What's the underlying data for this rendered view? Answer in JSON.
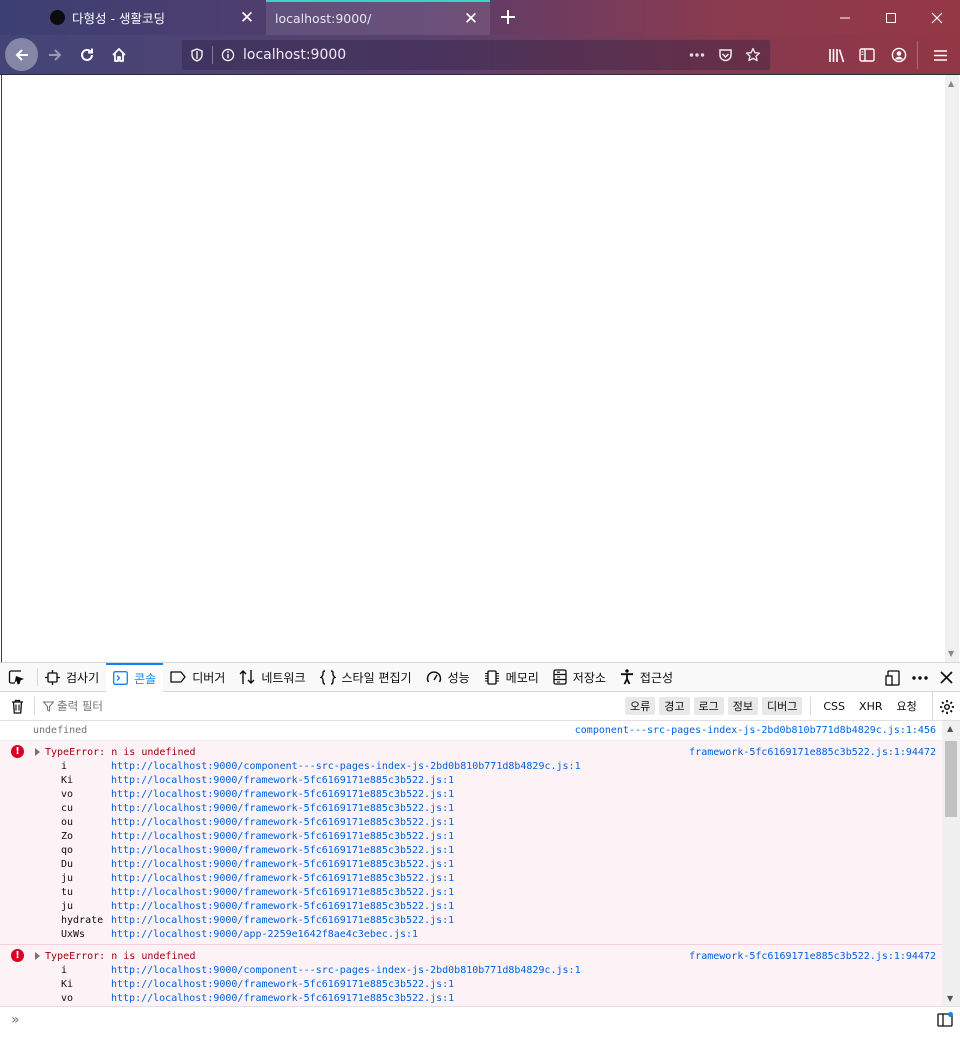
{
  "browser": {
    "tabs": [
      {
        "title": "다형성 - 생활코딩",
        "active": false
      },
      {
        "title": "localhost:9000/",
        "active": true
      }
    ],
    "url": "localhost:9000",
    "accent_color": "#39d3c7"
  },
  "devtools": {
    "tabs": [
      {
        "label": "검사기",
        "icon": "inspector-icon"
      },
      {
        "label": "콘솔",
        "icon": "console-icon",
        "selected": true
      },
      {
        "label": "디버거",
        "icon": "debugger-icon"
      },
      {
        "label": "네트워크",
        "icon": "network-icon"
      },
      {
        "label": "스타일 편집기",
        "icon": "style-editor-icon"
      },
      {
        "label": "성능",
        "icon": "performance-icon"
      },
      {
        "label": "메모리",
        "icon": "memory-icon"
      },
      {
        "label": "저장소",
        "icon": "storage-icon"
      },
      {
        "label": "접근성",
        "icon": "accessibility-icon"
      }
    ],
    "filter_placeholder": "출력 필터",
    "levels": [
      "오류",
      "경고",
      "로그",
      "정보",
      "디버그"
    ],
    "types": [
      "CSS",
      "XHR",
      "요청"
    ],
    "console": {
      "plain": {
        "text": "undefined",
        "location": "component---src-pages-index-js-2bd0b810b771d8b4829c.js:1:456"
      },
      "errors": [
        {
          "message": "TypeError: n is undefined",
          "location": "framework-5fc6169171e885c3b522.js:1:94472",
          "frames": [
            {
              "fn": "i",
              "src": "http://localhost:9000/component---src-pages-index-js-2bd0b810b771d8b4829c.js:1"
            },
            {
              "fn": "Ki",
              "src": "http://localhost:9000/framework-5fc6169171e885c3b522.js:1"
            },
            {
              "fn": "vo",
              "src": "http://localhost:9000/framework-5fc6169171e885c3b522.js:1"
            },
            {
              "fn": "cu",
              "src": "http://localhost:9000/framework-5fc6169171e885c3b522.js:1"
            },
            {
              "fn": "ou",
              "src": "http://localhost:9000/framework-5fc6169171e885c3b522.js:1"
            },
            {
              "fn": "Zo",
              "src": "http://localhost:9000/framework-5fc6169171e885c3b522.js:1"
            },
            {
              "fn": "qo",
              "src": "http://localhost:9000/framework-5fc6169171e885c3b522.js:1"
            },
            {
              "fn": "Du",
              "src": "http://localhost:9000/framework-5fc6169171e885c3b522.js:1"
            },
            {
              "fn": "ju",
              "src": "http://localhost:9000/framework-5fc6169171e885c3b522.js:1"
            },
            {
              "fn": "tu",
              "src": "http://localhost:9000/framework-5fc6169171e885c3b522.js:1"
            },
            {
              "fn": "ju",
              "src": "http://localhost:9000/framework-5fc6169171e885c3b522.js:1"
            },
            {
              "fn": "hydrate",
              "src": "http://localhost:9000/framework-5fc6169171e885c3b522.js:1"
            },
            {
              "fn": "UxWs",
              "src": "http://localhost:9000/app-2259e1642f8ae4c3ebec.js:1"
            }
          ]
        },
        {
          "message": "TypeError: n is undefined",
          "location": "framework-5fc6169171e885c3b522.js:1:94472",
          "frames": [
            {
              "fn": "i",
              "src": "http://localhost:9000/component---src-pages-index-js-2bd0b810b771d8b4829c.js:1"
            },
            {
              "fn": "Ki",
              "src": "http://localhost:9000/framework-5fc6169171e885c3b522.js:1"
            },
            {
              "fn": "vo",
              "src": "http://localhost:9000/framework-5fc6169171e885c3b522.js:1"
            }
          ]
        }
      ]
    },
    "input_prompt": "»"
  }
}
